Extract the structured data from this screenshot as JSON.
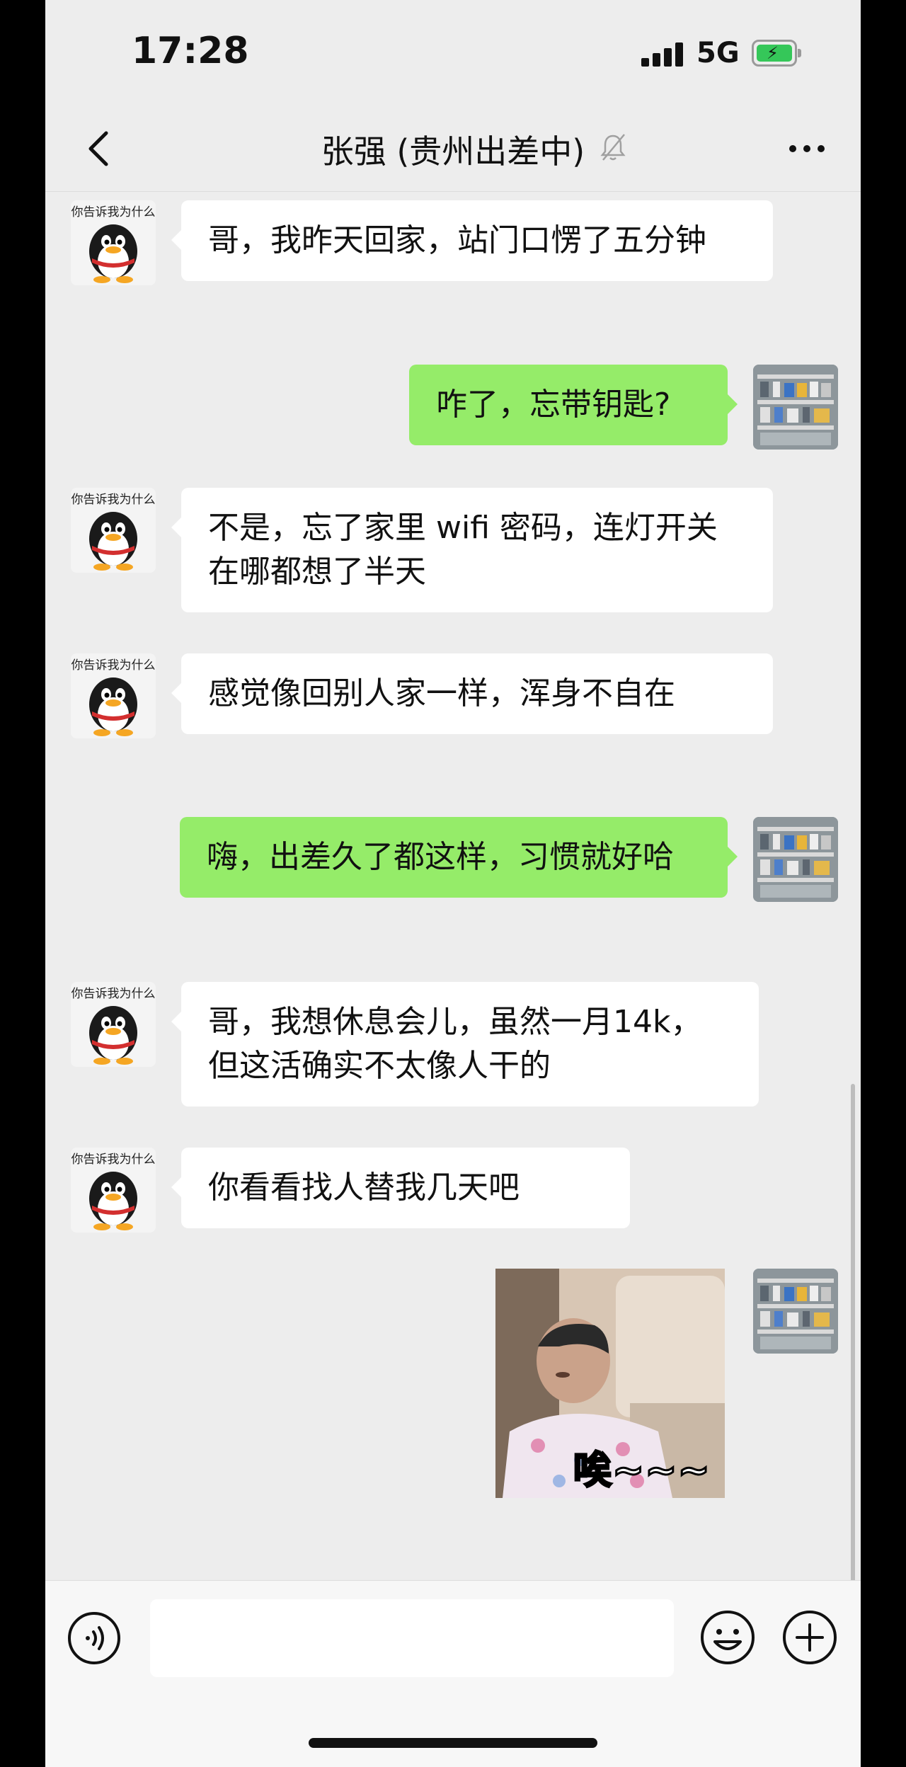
{
  "status_bar": {
    "time": "17:28",
    "network": "5G",
    "battery_charging": true,
    "battery_color": "#35c759"
  },
  "nav": {
    "title": "张强 (贵州出差中)",
    "muted": true
  },
  "contact": {
    "avatar_caption": "你告诉我为什么"
  },
  "messages": [
    {
      "side": "in",
      "text": "哥，我昨天回家，站门口愣了五分钟"
    },
    {
      "side": "out",
      "text": "咋了，忘带钥匙?"
    },
    {
      "side": "in",
      "text": "不是，忘了家里 wifi 密码，连灯开关在哪都想了半天"
    },
    {
      "side": "in",
      "text": "感觉像回别人家一样，浑身不自在"
    },
    {
      "side": "out",
      "text": "嗨，出差久了都这样，习惯就好哈"
    },
    {
      "side": "in",
      "text": "哥，我想休息会儿，虽然一月14k，但这活确实不太像人干的"
    },
    {
      "side": "in",
      "text": "你看看找人替我几天吧"
    },
    {
      "side": "out",
      "type": "sticker",
      "text": "唉~~~"
    }
  ],
  "colors": {
    "outgoing_bubble": "#95ec69",
    "incoming_bubble": "#ffffff",
    "background": "#ededed"
  },
  "input": {
    "placeholder": ""
  }
}
